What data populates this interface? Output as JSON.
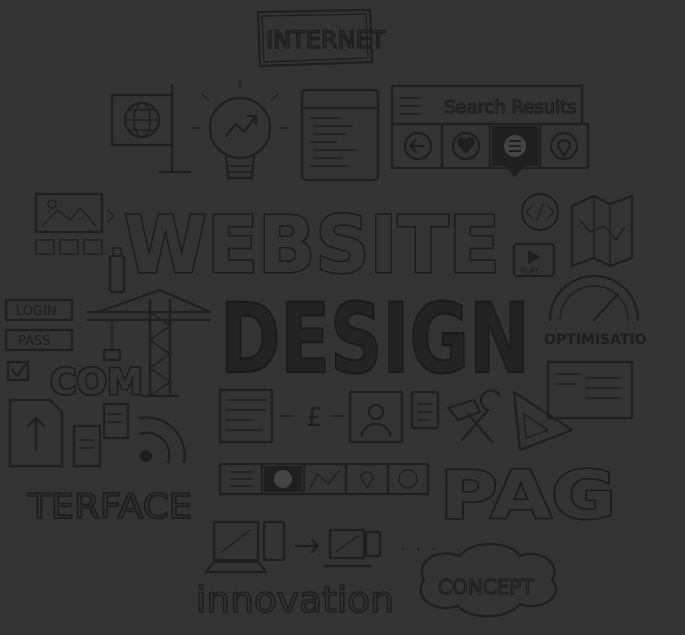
{
  "doodle": {
    "internet_label": "INTERNET",
    "search_results_label": "Search Results",
    "headline_top": "WEBSITE",
    "headline_bottom": "DESIGN",
    "login_label": "LOGIN",
    "pass_label": "PASS",
    "com_label": "COM",
    "optimisation_label": "OPTIMISATIO",
    "play_label": "PLAY",
    "currency_symbol": "£",
    "interface_label": "TERFACE",
    "page_label": "PAG",
    "innovation_label": "innovation",
    "concept_label": "CONCEPT",
    "ellipsis": ". . ."
  },
  "colors": {
    "background": "#333333",
    "ink": "#1f1f1f"
  }
}
